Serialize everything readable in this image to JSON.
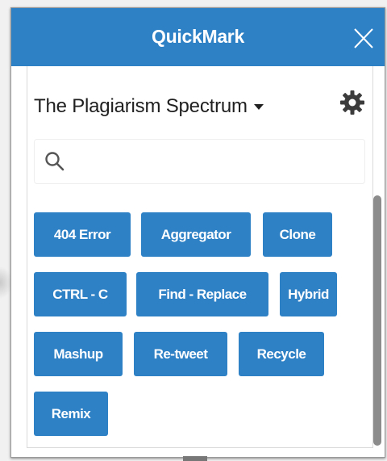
{
  "header": {
    "title": "QuickMark",
    "close_icon": "close-icon"
  },
  "project": {
    "title": "The Plagiarism Spectrum",
    "dropdown_icon": "caret-down-icon",
    "settings_icon": "gear-icon"
  },
  "search": {
    "icon": "search-icon",
    "value": "",
    "placeholder": ""
  },
  "tags": [
    {
      "label": "404 Error"
    },
    {
      "label": "Aggregator"
    },
    {
      "label": "Clone"
    },
    {
      "label": "CTRL - C"
    },
    {
      "label": "Find - Replace"
    },
    {
      "label": "Hybrid"
    },
    {
      "label": "Mashup"
    },
    {
      "label": "Re-tweet"
    },
    {
      "label": "Recycle"
    },
    {
      "label": "Remix"
    }
  ],
  "colors": {
    "accent": "#2f81c6",
    "header_text": "#ffffff",
    "body_text": "#202020"
  }
}
